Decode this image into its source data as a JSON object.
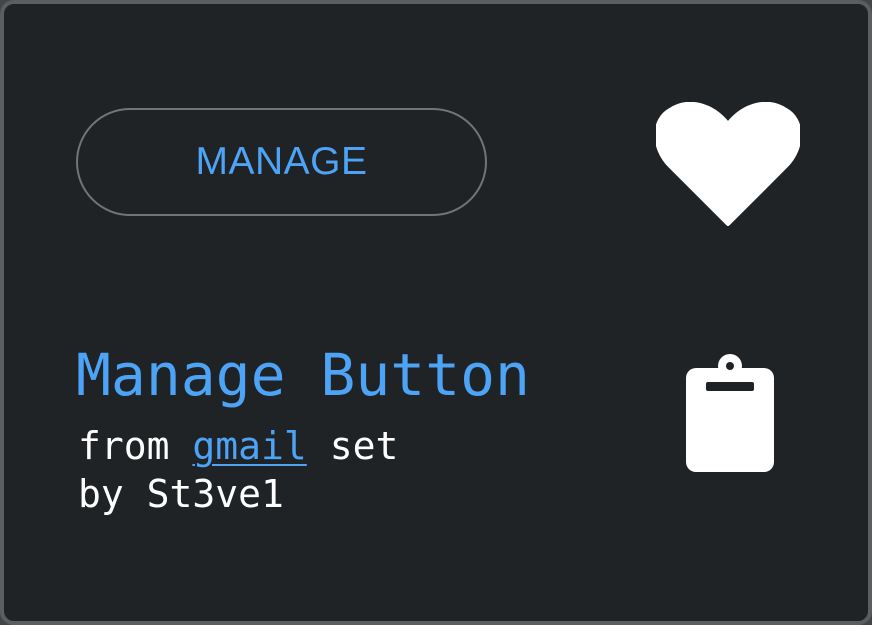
{
  "preview": {
    "button_label": "MANAGE"
  },
  "icons": {
    "favorite": "heart-icon",
    "copy": "clipboard-icon"
  },
  "info": {
    "title": "Manage Button",
    "from_prefix": "from",
    "set_name": "gmail",
    "set_suffix": "set",
    "author_prefix": "by",
    "author": "St3ve1"
  },
  "colors": {
    "background": "#1f2325",
    "border": "#5b5d60",
    "accent": "#4da3f5",
    "text": "#ffffff",
    "button_outline": "#727476"
  }
}
